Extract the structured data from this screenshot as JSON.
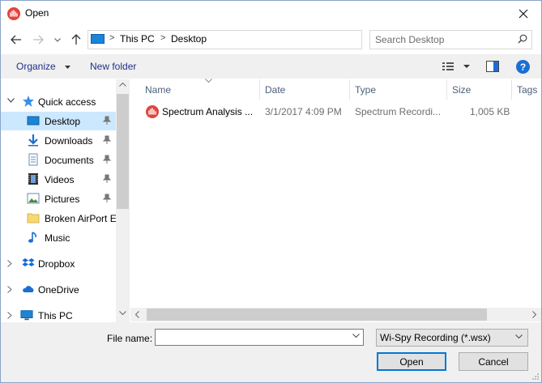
{
  "window": {
    "title": "Open"
  },
  "address": {
    "crumbs": [
      "This PC",
      "Desktop"
    ],
    "sep": ">"
  },
  "search": {
    "placeholder": "Search Desktop"
  },
  "toolbar": {
    "organize": "Organize",
    "new_folder": "New folder",
    "help": "?"
  },
  "nav": {
    "quick_access": "Quick access",
    "items": [
      {
        "label": "Desktop",
        "pinned": true,
        "icon": "desktop-icon"
      },
      {
        "label": "Downloads",
        "pinned": true,
        "icon": "download-arrow-icon"
      },
      {
        "label": "Documents",
        "pinned": true,
        "icon": "documents-icon"
      },
      {
        "label": "Videos",
        "pinned": true,
        "icon": "videos-icon"
      },
      {
        "label": "Pictures",
        "pinned": true,
        "icon": "pictures-icon"
      },
      {
        "label": "Broken AirPort E",
        "pinned": false,
        "icon": "folder-icon"
      },
      {
        "label": "Music",
        "pinned": false,
        "icon": "music-note-icon"
      }
    ],
    "dropbox": "Dropbox",
    "onedrive": "OneDrive",
    "thispc": "This PC"
  },
  "columns": [
    "Name",
    "Date",
    "Type",
    "Size",
    "Tags"
  ],
  "files": [
    {
      "name": "Spectrum Analysis ...",
      "date": "3/1/2017 4:09 PM",
      "type": "Spectrum Recordi...",
      "size": "1,005 KB"
    }
  ],
  "bottom": {
    "file_name_label": "File name:",
    "file_name_value": "",
    "file_type": "Wi-Spy Recording (*.wsx)",
    "open": "Open",
    "cancel": "Cancel"
  },
  "colors": {
    "accent": "#0078d7",
    "selection": "#cce8ff",
    "app_icon": "#e2443c"
  }
}
